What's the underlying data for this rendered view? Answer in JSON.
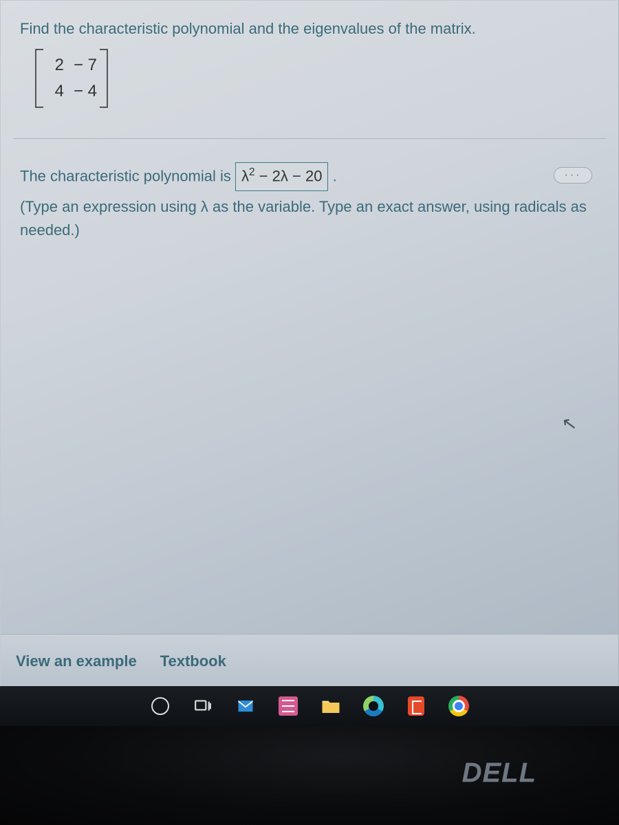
{
  "question": {
    "prompt": "Find the characteristic polynomial and the eigenvalues of the matrix.",
    "matrix": {
      "r1c1": "2",
      "r1c2": "− 7",
      "r2c1": "4",
      "r2c2": "− 4"
    }
  },
  "answer": {
    "lead": "The characteristic polynomial is ",
    "boxed_html": "λ<sup>2</sup> − 2λ − 20",
    "trail": ".",
    "hint": "(Type an expression using λ as the variable. Type an exact answer, using radicals as needed.)"
  },
  "help": {
    "view_example": "View an example",
    "textbook": "Textbook"
  },
  "more_label": "···",
  "brand": "DELL"
}
